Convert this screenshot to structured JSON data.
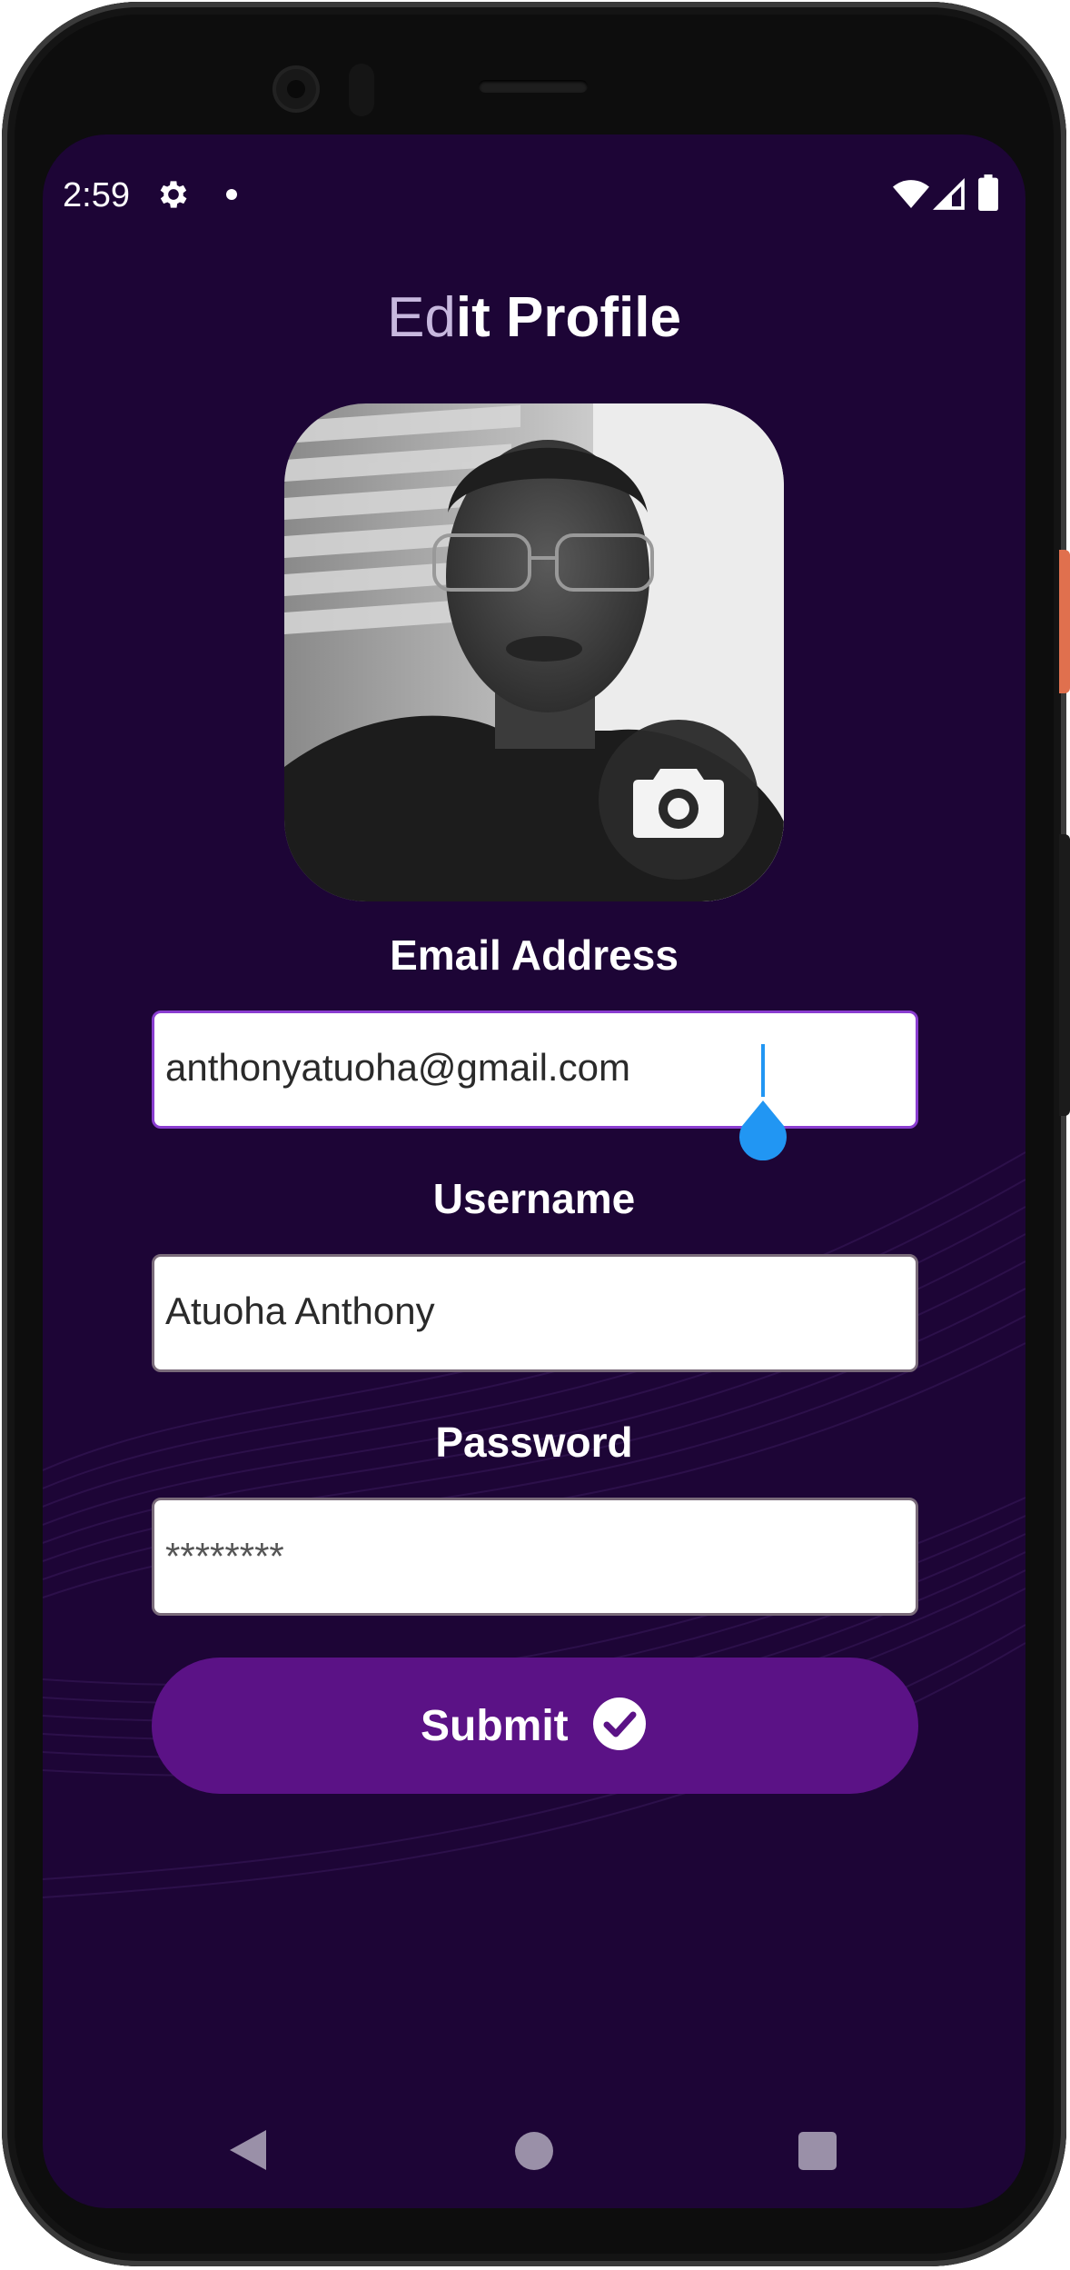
{
  "status_bar": {
    "time": "2:59",
    "icons": [
      "settings-icon",
      "notification-dot",
      "wifi-icon",
      "signal-icon",
      "battery-icon"
    ]
  },
  "page": {
    "title_light": "Ed",
    "title_bold": "it Profile"
  },
  "avatar": {
    "description_icon": "profile-photo",
    "change_photo_icon": "camera-icon"
  },
  "form": {
    "email": {
      "label": "Email Address",
      "value": "anthonyatuoha@gmail.com"
    },
    "username": {
      "label": "Username",
      "value": "Atuoha Anthony"
    },
    "password": {
      "label": "Password",
      "placeholder": "********"
    },
    "submit": {
      "label": "Submit",
      "icon": "check-circle-icon"
    }
  },
  "nav_bar": {
    "buttons": [
      "back",
      "home",
      "recents"
    ]
  },
  "colors": {
    "background": "#1d0536",
    "accent": "#5b1286",
    "focus_border": "#8a3dd0",
    "cursor": "#2196f3"
  }
}
